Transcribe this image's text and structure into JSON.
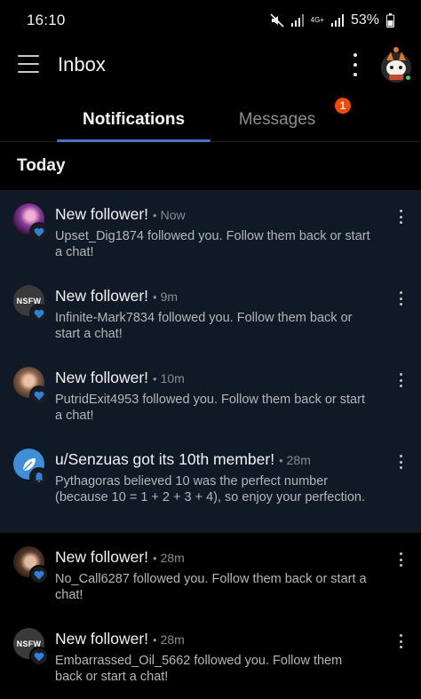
{
  "status_bar": {
    "time": "16:10",
    "network": "4G+",
    "battery": "53%"
  },
  "app_bar": {
    "title": "Inbox"
  },
  "tabs": [
    {
      "label": "Notifications",
      "active": true
    },
    {
      "label": "Messages",
      "active": false,
      "badge": "1"
    }
  ],
  "section": {
    "title": "Today"
  },
  "notifications": [
    {
      "title": "New follower!",
      "time": "Now",
      "body": "Upset_Dig1874 followed you. Follow them back or start a chat!",
      "avatar": "purple-photo",
      "icon": "heart-icon",
      "unread": true
    },
    {
      "title": "New follower!",
      "time": "9m",
      "body": "Infinite-Mark7834 followed you. Follow them back or start a chat!",
      "avatar": "NSFW",
      "icon": "heart-icon",
      "unread": true
    },
    {
      "title": "New follower!",
      "time": "10m",
      "body": "PutridExit4953 followed you. Follow them back or start a chat!",
      "avatar": "woman-photo",
      "icon": "heart-icon",
      "unread": true
    },
    {
      "title": "u/Senzuas got its 10th member!",
      "time": "28m",
      "body": "Pythagoras believed 10 was the perfect number (because 10 = 1 + 2 + 3 + 4), so enjoy your perfection.",
      "avatar": "community-leaf",
      "icon": "bell-icon",
      "unread": true
    },
    {
      "title": "New follower!",
      "time": "28m",
      "body": "No_Call6287 followed you. Follow them back or start a chat!",
      "avatar": "woman-photo",
      "icon": "heart-icon",
      "unread": false
    },
    {
      "title": "New follower!",
      "time": "28m",
      "body": "Embarrassed_Oil_5662 followed you. Follow them back or start a chat!",
      "avatar": "NSFW",
      "icon": "heart-icon",
      "unread": false
    }
  ],
  "colors": {
    "background": "#000000",
    "unread_background": "#0f1a26",
    "accent": "#3a78d0",
    "badge": "#ff4500",
    "online": "#46d160"
  }
}
